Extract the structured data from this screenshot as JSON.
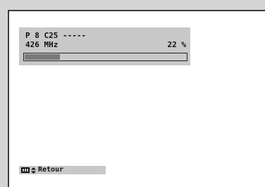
{
  "channel_info": {
    "line1": "P 8 C25 -----",
    "line2": "426 MHz",
    "percent_label": "22 %",
    "progress_fraction": 0.22
  },
  "footer": {
    "menu_icon": "menu-icon",
    "nav_icon": "up-down-arrows-icon",
    "back_label": "Retour"
  },
  "colors": {
    "panel": "#c8c8c8",
    "progress_fill": "#7a7a7a",
    "screen": "#ffffff"
  }
}
